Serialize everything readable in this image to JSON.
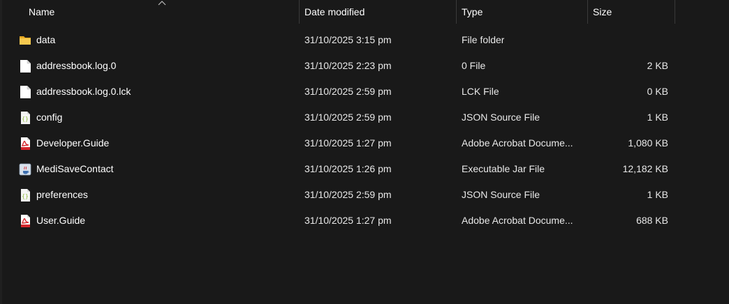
{
  "columns": {
    "name": "Name",
    "date": "Date modified",
    "type": "Type",
    "size": "Size"
  },
  "sort": {
    "column": "name",
    "direction": "ascending"
  },
  "files": [
    {
      "name": "data",
      "date": "31/10/2025 3:15 pm",
      "type": "File folder",
      "size": "",
      "icon": "folder-icon"
    },
    {
      "name": "addressbook.log.0",
      "date": "31/10/2025 2:23 pm",
      "type": "0 File",
      "size": "2 KB",
      "icon": "file-icon"
    },
    {
      "name": "addressbook.log.0.lck",
      "date": "31/10/2025 2:59 pm",
      "type": "LCK File",
      "size": "0 KB",
      "icon": "file-icon"
    },
    {
      "name": "config",
      "date": "31/10/2025 2:59 pm",
      "type": "JSON Source File",
      "size": "1 KB",
      "icon": "json-file-icon"
    },
    {
      "name": "Developer.Guide",
      "date": "31/10/2025 1:27 pm",
      "type": "Adobe Acrobat Docume...",
      "size": "1,080 KB",
      "icon": "pdf-file-icon"
    },
    {
      "name": "MediSaveContact",
      "date": "31/10/2025 1:26 pm",
      "type": "Executable Jar File",
      "size": "12,182 KB",
      "icon": "jar-file-icon"
    },
    {
      "name": "preferences",
      "date": "31/10/2025 2:59 pm",
      "type": "JSON Source File",
      "size": "1 KB",
      "icon": "json-file-icon"
    },
    {
      "name": "User.Guide",
      "date": "31/10/2025 1:27 pm",
      "type": "Adobe Acrobat Docume...",
      "size": "688 KB",
      "icon": "pdf-file-icon"
    }
  ],
  "colors": {
    "background": "#191919",
    "text": "#ffffff",
    "folder": "#f2c14e",
    "pdf_red": "#d4262c",
    "json_green": "#8dba3c"
  }
}
